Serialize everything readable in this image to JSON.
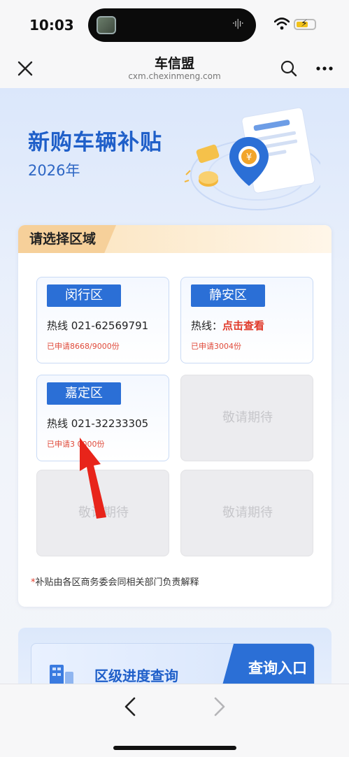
{
  "status_bar": {
    "time": "10:03"
  },
  "nav": {
    "title": "车信盟",
    "subtitle": "cxm.chexinmeng.com"
  },
  "hero": {
    "title": "新购车辆补贴",
    "year": "2026年",
    "coin_symbol": "¥"
  },
  "region_section": {
    "title": "请选择区域"
  },
  "districts": [
    {
      "name": "闵行区",
      "hotline": "热线 021-62569791",
      "applied": "已申请8668/9000份"
    },
    {
      "name": "静安区",
      "hotline_label": "热线：",
      "hotline_link": "点击查看",
      "applied": "已申请3004份"
    },
    {
      "name": "嘉定区",
      "hotline": "热线 021-32233305",
      "applied": "已申请3 0000份"
    }
  ],
  "placeholder_label": "敬请期待",
  "footnote": {
    "star": "*",
    "text": "补贴由各区商务委会同相关部门负责解释"
  },
  "query": {
    "label": "区级进度查询",
    "button": "查询入口"
  },
  "colors": {
    "accent": "#2b6fd6",
    "header_orange": "#f6d09a",
    "warning_red": "#e03a2a"
  }
}
